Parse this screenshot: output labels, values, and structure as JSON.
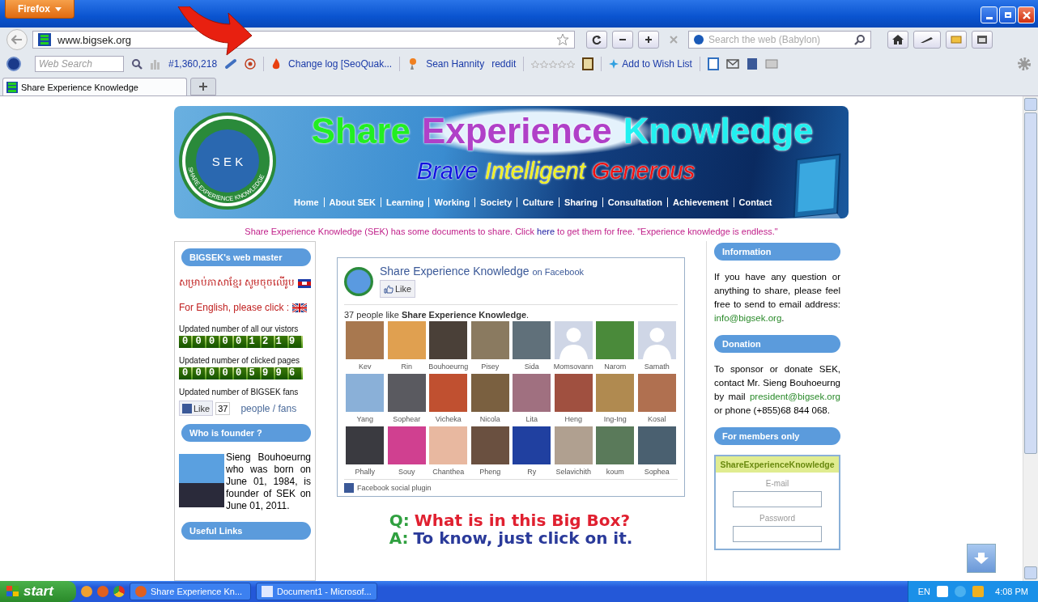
{
  "browser": {
    "menu_button": "Firefox",
    "url": "www.bigsek.org",
    "search_placeholder": "Search the web (Babylon)"
  },
  "toolbar": {
    "web_search_placeholder": "Web Search",
    "rank": "#1,360,218",
    "changelog": "Change log [SeoQuak...",
    "links": [
      "Sean Hannity",
      "reddit"
    ],
    "wish_list": "Add to Wish List"
  },
  "tabs": [
    {
      "label": "Share Experience Knowledge",
      "selected": true
    }
  ],
  "banner": {
    "logo_initials": "S E K",
    "logo_ring": "SHARE EXPERIENCE KNOWLEDGE",
    "title_words": [
      {
        "text": "Share",
        "color": "#22ee22"
      },
      {
        "text": "Experience",
        "color": "#b040c8"
      },
      {
        "text": "Knowledge",
        "color": "#22f0f0"
      }
    ],
    "slogan_words": [
      {
        "text": "Brave",
        "color": "#1010e0"
      },
      {
        "text": "Intelligent",
        "color": "#f0f020"
      },
      {
        "text": "Generous",
        "color": "#f01010"
      }
    ],
    "nav": [
      "Home",
      "About SEK",
      "Learning",
      "Working",
      "Society",
      "Culture",
      "Sharing",
      "Consultation",
      "Achievement",
      "Contact"
    ]
  },
  "announcement": {
    "before": "Share Experience Knowledge (SEK) has some documents to share. Click ",
    "link": "here",
    "after": " to get them for free. \"Experience knowledge is endless.\""
  },
  "left": {
    "webmaster_heading": "BIGSEK's web master",
    "khmer_link": "សម្រាប់ភាសាខ្មែរ សូមចុចលើរូប",
    "english_link": "For English, please click :",
    "visitors_label": "Updated number of all our vistors",
    "visitors": "000001219",
    "pages_label": "Updated number of clicked pages",
    "pages": "000005996",
    "fans_label": "Updated number of BIGSEK fans",
    "like": "Like",
    "like_count": "37",
    "fans_text": "people / fans",
    "founder_heading": "Who is founder ?",
    "founder_text": "Sieng Bouhoeurng who was born on June 01, 1984, is founder of SEK on June 01, 2011.",
    "links_heading": "Useful Links"
  },
  "facebook": {
    "page_name": "Share Experience Knowledge",
    "on_facebook": "on Facebook",
    "like": "Like",
    "likes_text": "37 people like **Share Experience Knowledge**.",
    "fans": [
      {
        "name": "Kev",
        "kind": "photo"
      },
      {
        "name": "Rin",
        "kind": "photo"
      },
      {
        "name": "Bouhoeurng",
        "kind": "photo"
      },
      {
        "name": "Pisey",
        "kind": "photo"
      },
      {
        "name": "Sida",
        "kind": "photo"
      },
      {
        "name": "Momsovann",
        "kind": "silhouette"
      },
      {
        "name": "Narom",
        "kind": "photo"
      },
      {
        "name": "Samath",
        "kind": "silhouette"
      },
      {
        "name": "Yang",
        "kind": "photo"
      },
      {
        "name": "Sophear",
        "kind": "photo"
      },
      {
        "name": "Vicheka",
        "kind": "photo"
      },
      {
        "name": "Nicola",
        "kind": "photo"
      },
      {
        "name": "Lita",
        "kind": "photo"
      },
      {
        "name": "Heng",
        "kind": "photo"
      },
      {
        "name": "Ing-Ing",
        "kind": "photo"
      },
      {
        "name": "Kosal",
        "kind": "photo"
      },
      {
        "name": "Phally",
        "kind": "photo"
      },
      {
        "name": "Souy",
        "kind": "photo"
      },
      {
        "name": "Chanthea",
        "kind": "photo"
      },
      {
        "name": "Pheng",
        "kind": "photo"
      },
      {
        "name": "Ry",
        "kind": "photo"
      },
      {
        "name": "Selavichith",
        "kind": "photo"
      },
      {
        "name": "koum",
        "kind": "photo"
      },
      {
        "name": "Sophea",
        "kind": "photo"
      }
    ],
    "plugin": "Facebook social plugin"
  },
  "qa": {
    "q_mark": "Q:",
    "question": "What is in this Big Box?",
    "a_mark": "A:",
    "answer": "To know, just click on it."
  },
  "right": {
    "info_heading": "Information",
    "info_text": "If you have any question or anything to share, please feel free to send to email address:",
    "info_email": "info@bigsek.org",
    "info_end": ".",
    "donation_heading": "Donation",
    "donation_before": "To sponsor or donate SEK, contact Mr. Sieng Bouhoeurng by mail ",
    "donation_email": "president@bigsek.org",
    "donation_after": " or phone (+855)68 844 068.",
    "members_heading": "For members only",
    "login_title": "ShareExperienceKnowledge",
    "email_label": "E-mail",
    "password_label": "Password"
  },
  "taskbar": {
    "start": "start",
    "tasks": [
      "Share Experience Kn...",
      "Document1 - Microsof..."
    ],
    "language": "EN",
    "time": "4:08 PM"
  }
}
